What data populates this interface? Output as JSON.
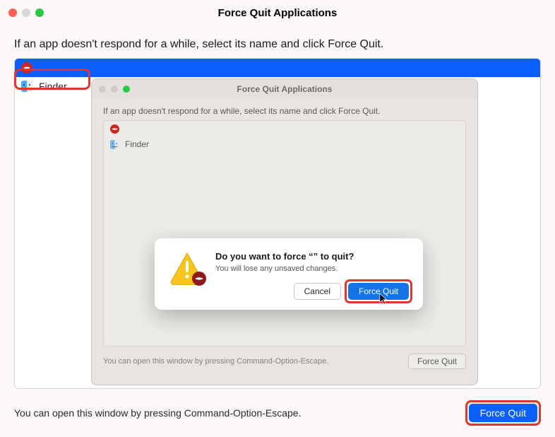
{
  "window": {
    "title": "Force Quit Applications",
    "instruction": "If an app doesn't respond for a while, select its name and click Force Quit.",
    "apps": [
      {
        "name": "",
        "selected": true
      },
      {
        "name": "Finder",
        "selected": false
      }
    ],
    "footer_hint": "You can open this window by pressing Command-Option-Escape.",
    "force_quit_label": "Force Quit"
  },
  "nested": {
    "title": "Force Quit Applications",
    "instruction": "If an app doesn't respond for a while, select its name and click Force Quit.",
    "apps": [
      {
        "name": ""
      },
      {
        "name": "Finder"
      }
    ],
    "footer_hint": "You can open this window by pressing Command-Option-Escape.",
    "force_quit_label": "Force Quit"
  },
  "dialog": {
    "heading": "Do you want to force “” to quit?",
    "message": "You will lose any unsaved changes.",
    "cancel_label": "Cancel",
    "confirm_label": "Force Quit"
  }
}
